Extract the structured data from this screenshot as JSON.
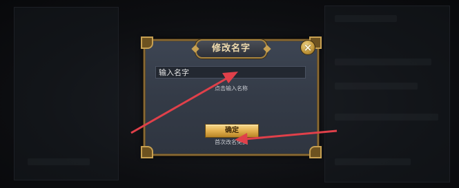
{
  "dialog": {
    "title": "修改名字",
    "close_glyph": "×",
    "input": {
      "value": "",
      "placeholder": "输入名字"
    },
    "hint": "点击输入名称",
    "confirm_label": "确定",
    "free_note": "首次改名免费"
  },
  "colors": {
    "frame_gold": "#8a6a34",
    "button_gold": "#e2b04f",
    "arrow_red": "#e0404a"
  }
}
